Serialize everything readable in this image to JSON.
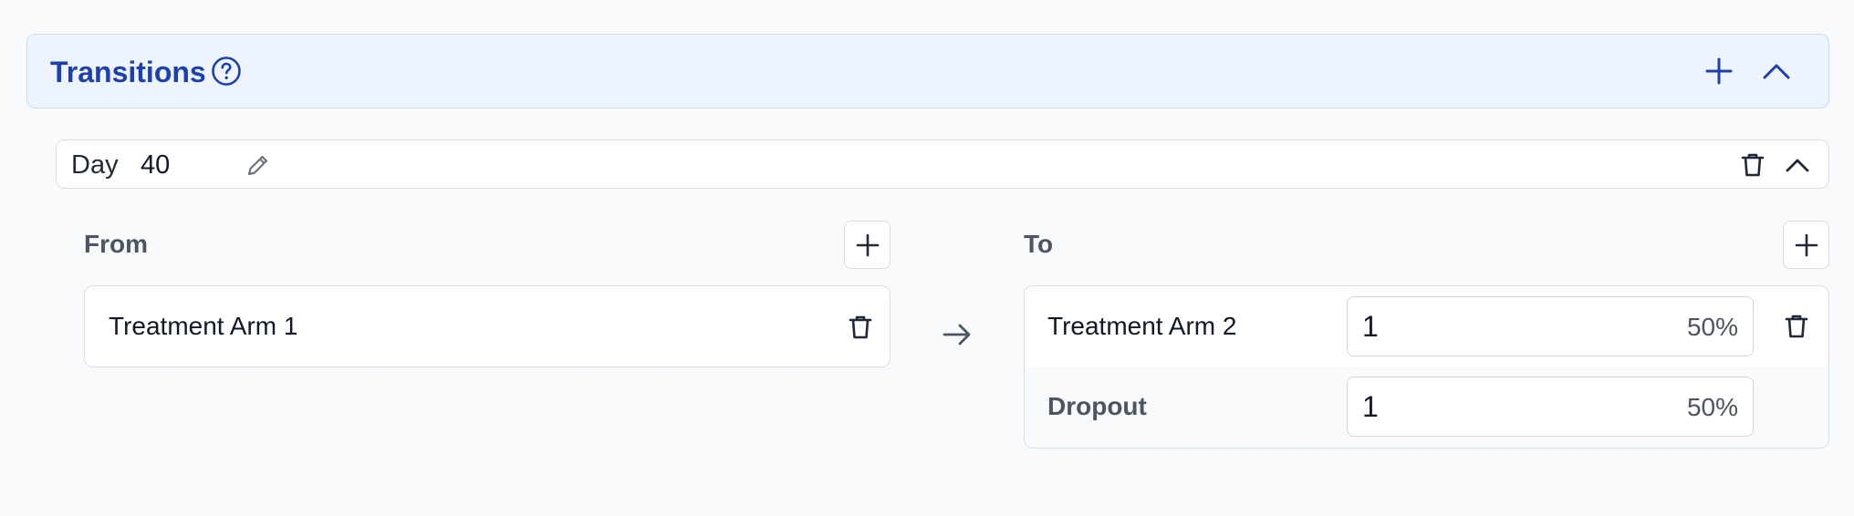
{
  "section": {
    "title": "Transitions"
  },
  "day": {
    "label": "Day",
    "value": "40"
  },
  "from": {
    "title": "From",
    "arms": [
      {
        "name": "Treatment Arm 1"
      }
    ]
  },
  "to": {
    "title": "To",
    "rows": [
      {
        "name": "Treatment Arm 2",
        "value": "1",
        "percent": "50%"
      },
      {
        "name": "Dropout",
        "value": "1",
        "percent": "50%"
      }
    ]
  },
  "icons": {
    "help": "help-circle-icon",
    "add": "plus-icon",
    "collapse": "chevron-up-icon",
    "edit": "pencil-icon",
    "delete": "trash-icon",
    "arrow": "arrow-right-icon"
  },
  "colors": {
    "accent": "#1e40af",
    "header_bg": "#eef4fd",
    "page_bg": "#f8fafc"
  }
}
